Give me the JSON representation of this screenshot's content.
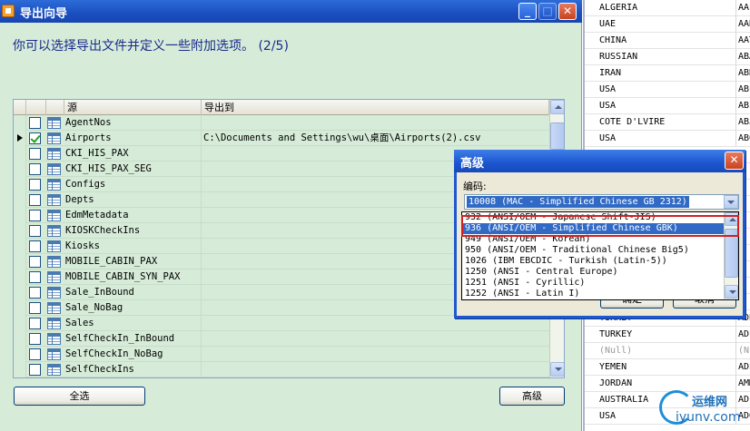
{
  "wizard": {
    "title": "导出向导",
    "heading": "你可以选择导出文件并定义一些附加选项。 (2/5)",
    "controls": {
      "minimize": "_",
      "maximize": "□",
      "close": "✕"
    },
    "columns": {
      "source": "源",
      "dest": "导出到"
    },
    "rows": [
      {
        "source": "AgentNos",
        "dest": "",
        "checked": false,
        "current": false
      },
      {
        "source": "Airports",
        "dest": "C:\\Documents and Settings\\wu\\桌面\\Airports(2).csv",
        "checked": true,
        "current": true
      },
      {
        "source": "CKI_HIS_PAX",
        "dest": "",
        "checked": false,
        "current": false
      },
      {
        "source": "CKI_HIS_PAX_SEG",
        "dest": "",
        "checked": false,
        "current": false
      },
      {
        "source": "Configs",
        "dest": "",
        "checked": false,
        "current": false
      },
      {
        "source": "Depts",
        "dest": "",
        "checked": false,
        "current": false
      },
      {
        "source": "EdmMetadata",
        "dest": "",
        "checked": false,
        "current": false
      },
      {
        "source": "KIOSKCheckIns",
        "dest": "",
        "checked": false,
        "current": false
      },
      {
        "source": "Kiosks",
        "dest": "",
        "checked": false,
        "current": false
      },
      {
        "source": "MOBILE_CABIN_PAX",
        "dest": "",
        "checked": false,
        "current": false
      },
      {
        "source": "MOBILE_CABIN_SYN_PAX",
        "dest": "",
        "checked": false,
        "current": false
      },
      {
        "source": "Sale_InBound",
        "dest": "",
        "checked": false,
        "current": false
      },
      {
        "source": "Sale_NoBag",
        "dest": "",
        "checked": false,
        "current": false
      },
      {
        "source": "Sales",
        "dest": "",
        "checked": false,
        "current": false
      },
      {
        "source": "SelfCheckIn_InBound",
        "dest": "",
        "checked": false,
        "current": false
      },
      {
        "source": "SelfCheckIn_NoBag",
        "dest": "",
        "checked": false,
        "current": false
      },
      {
        "source": "SelfCheckIns",
        "dest": "",
        "checked": false,
        "current": false
      }
    ],
    "buttons": {
      "select_all": "全选",
      "advanced": "高级"
    }
  },
  "background_list": {
    "rows": [
      {
        "c1": "ALGERIA",
        "c2": "AAE",
        "null": false
      },
      {
        "c1": "UAE",
        "c2": "AAN",
        "null": false
      },
      {
        "c1": "CHINA",
        "c2": "AAT",
        "null": false
      },
      {
        "c1": "RUSSIAN",
        "c2": "ABA",
        "null": false
      },
      {
        "c1": "IRAN",
        "c2": "ABD",
        "null": false
      },
      {
        "c1": "USA",
        "c2": "ABE",
        "null": false
      },
      {
        "c1": "USA",
        "c2": "ABI",
        "null": false
      },
      {
        "c1": "COTE D'LVIRE",
        "c2": "ABJ",
        "null": false
      },
      {
        "c1": "USA",
        "c2": "ABQ",
        "null": false
      },
      {
        "c1": "",
        "c2": "",
        "null": false
      },
      {
        "c1": "",
        "c2": "",
        "null": false
      },
      {
        "c1": "",
        "c2": "",
        "null": false
      },
      {
        "c1": "",
        "c2": "",
        "null": false
      },
      {
        "c1": "",
        "c2": "",
        "null": false
      },
      {
        "c1": "",
        "c2": "",
        "null": false
      },
      {
        "c1": "",
        "c2": "",
        "null": false
      },
      {
        "c1": "",
        "c2": "",
        "null": false
      },
      {
        "c1": "",
        "c2": "",
        "null": false
      },
      {
        "c1": "",
        "c2": "",
        "null": false
      },
      {
        "c1": "TURKEY",
        "c2": "ADB",
        "null": false
      },
      {
        "c1": "TURKEY",
        "c2": "ADE",
        "null": false
      },
      {
        "c1": "(Null)",
        "c2": "(Nu",
        "null": true
      },
      {
        "c1": "YEMEN",
        "c2": "ADE",
        "null": false
      },
      {
        "c1": "JORDAN",
        "c2": "AMM",
        "null": false
      },
      {
        "c1": "AUSTRALIA",
        "c2": "ADL",
        "null": false
      },
      {
        "c1": "USA",
        "c2": "ADQ",
        "null": false
      }
    ]
  },
  "advanced_dialog": {
    "title": "高级",
    "close": "✕",
    "encoding_label": "编码:",
    "encoding_selected": "10008 (MAC - Simplified Chinese GB 2312)",
    "ok_label": "确定",
    "cancel_label": "取消",
    "encoding_options": [
      {
        "label": "932 (ANSI/OEM - Japanese Shift-JIS)",
        "selected": false
      },
      {
        "label": "936 (ANSI/OEM - Simplified Chinese GBK)",
        "selected": true
      },
      {
        "label": "949 (ANSI/OEM - Korean)",
        "selected": false
      },
      {
        "label": "950 (ANSI/OEM - Traditional Chinese Big5)",
        "selected": false
      },
      {
        "label": "1026 (IBM EBCDIC - Turkish (Latin-5))",
        "selected": false
      },
      {
        "label": "1250 (ANSI - Central Europe)",
        "selected": false
      },
      {
        "label": "1251 (ANSI - Cyrillic)",
        "selected": false
      },
      {
        "label": "1252 (ANSI - Latin I)",
        "selected": false
      }
    ]
  },
  "watermark": {
    "name": "运维网",
    "url": "iyunv.com"
  },
  "colors": {
    "title_bar": "#1a4fbf",
    "window_bg": "#d6ecd9",
    "selection": "#316ac5",
    "highlight_box": "#d02020"
  }
}
